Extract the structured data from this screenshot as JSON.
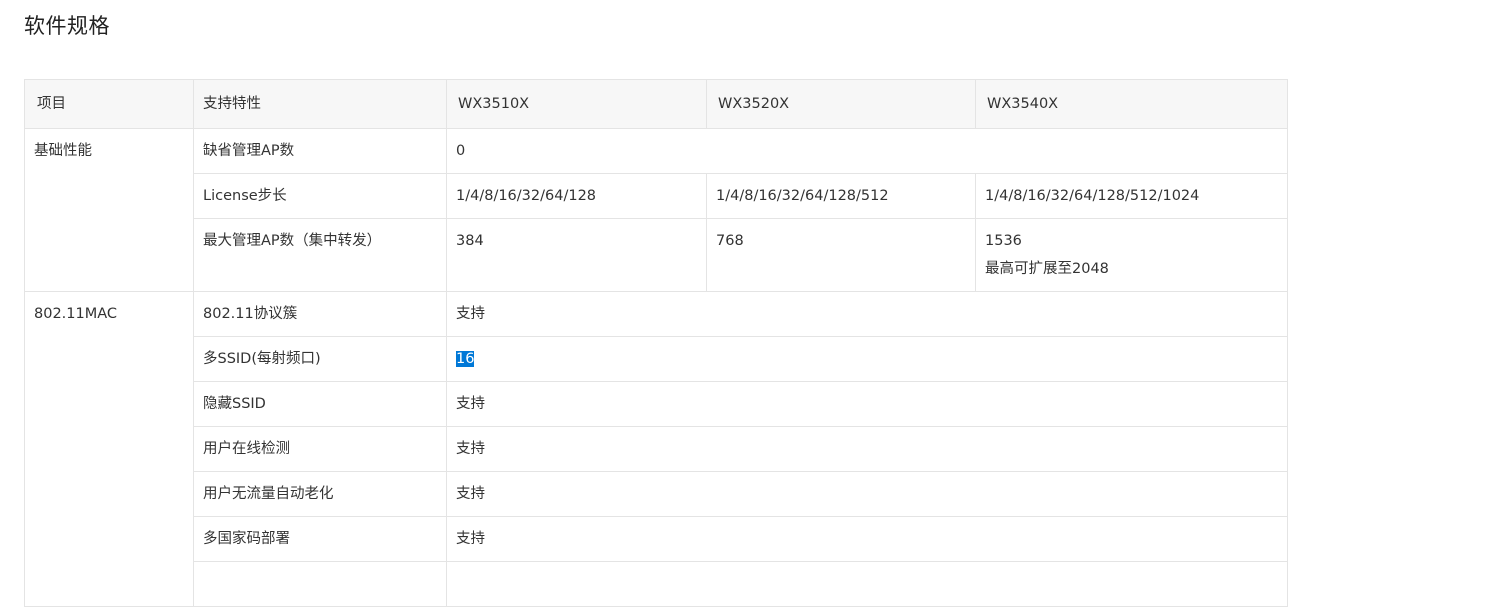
{
  "page_title": "软件规格",
  "header": {
    "col_item": "项目",
    "col_feature": "支持特性",
    "model_1": "WX3510X",
    "model_2": "WX3520X",
    "model_3": "WX3540X"
  },
  "groups": {
    "basic": {
      "category": "基础性能",
      "rows": {
        "default_ap": {
          "feature": "缺省管理AP数",
          "value": "0"
        },
        "license_step": {
          "feature": "License步长",
          "values": [
            "1/4/8/16/32/64/128",
            "1/4/8/16/32/64/128/512",
            "1/4/8/16/32/64/128/512/1024"
          ]
        },
        "max_ap": {
          "feature": "最大管理AP数（集中转发）",
          "values": [
            "384",
            "768",
            "1536"
          ],
          "extra": "最高可扩展至2048"
        }
      }
    },
    "mac": {
      "category": "802.11MAC",
      "rows": [
        {
          "feature": "802.11协议簇",
          "value": "支持"
        },
        {
          "feature": "多SSID(每射频口)",
          "value": "16"
        },
        {
          "feature": "隐藏SSID",
          "value": "支持"
        },
        {
          "feature": "用户在线检测",
          "value": "支持"
        },
        {
          "feature": "用户无流量自动老化",
          "value": "支持"
        },
        {
          "feature": "多国家码部署",
          "value": "支持"
        }
      ]
    }
  }
}
